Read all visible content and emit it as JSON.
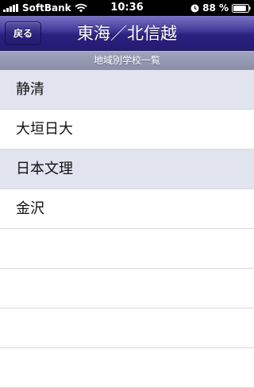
{
  "status_bar": {
    "carrier": "SoftBank",
    "time": "10:36",
    "battery_percent": "88 %",
    "signal_bars": 5,
    "battery_level": 0.88,
    "icons": [
      "signal-icon",
      "wifi-icon",
      "clock-icon",
      "battery-icon"
    ]
  },
  "nav": {
    "back_label": "戻る",
    "title": "東海／北信越"
  },
  "section": {
    "header": "地域別学校一覧"
  },
  "schools": [
    {
      "name": "静清"
    },
    {
      "name": "大垣日大"
    },
    {
      "name": "日本文理"
    },
    {
      "name": "金沢"
    }
  ],
  "empty_rows": 4,
  "colors": {
    "nav_bar": "#2a217f",
    "section_header": "#8a8da8",
    "row_shaded": "#e1e4ef",
    "row_plain": "#ffffff",
    "separator": "#d9d9d9"
  }
}
